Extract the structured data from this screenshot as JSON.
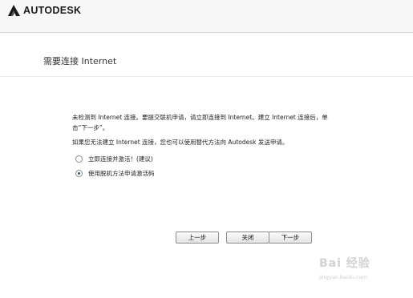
{
  "app": {
    "brand": "AUTODESK",
    "logo_icon": "autodesk-logo-icon"
  },
  "page": {
    "title": "需要连接 Internet"
  },
  "message": {
    "line1": "未检测到 Internet 连接。要提交联机申请，请立即连接到 Internet。建立 Internet 连接后，单击“下一步”。",
    "line2": "如果您无法建立 Internet 连接，您也可以使用替代方法向 Autodesk 发送申请。"
  },
  "options": [
    {
      "label": "立即连接并激活！(建议)",
      "checked": false
    },
    {
      "label": "使用脱机方法申请激活码",
      "checked": true
    }
  ],
  "buttons": {
    "back": "上一步",
    "close": "关闭",
    "next": "下一步"
  },
  "watermark": {
    "main": "Bai 经验",
    "sub": "jingyan.baidu.com"
  },
  "colors": {
    "header_bg": "#f7f7f7",
    "radio_checked": "#1e5aa8"
  }
}
